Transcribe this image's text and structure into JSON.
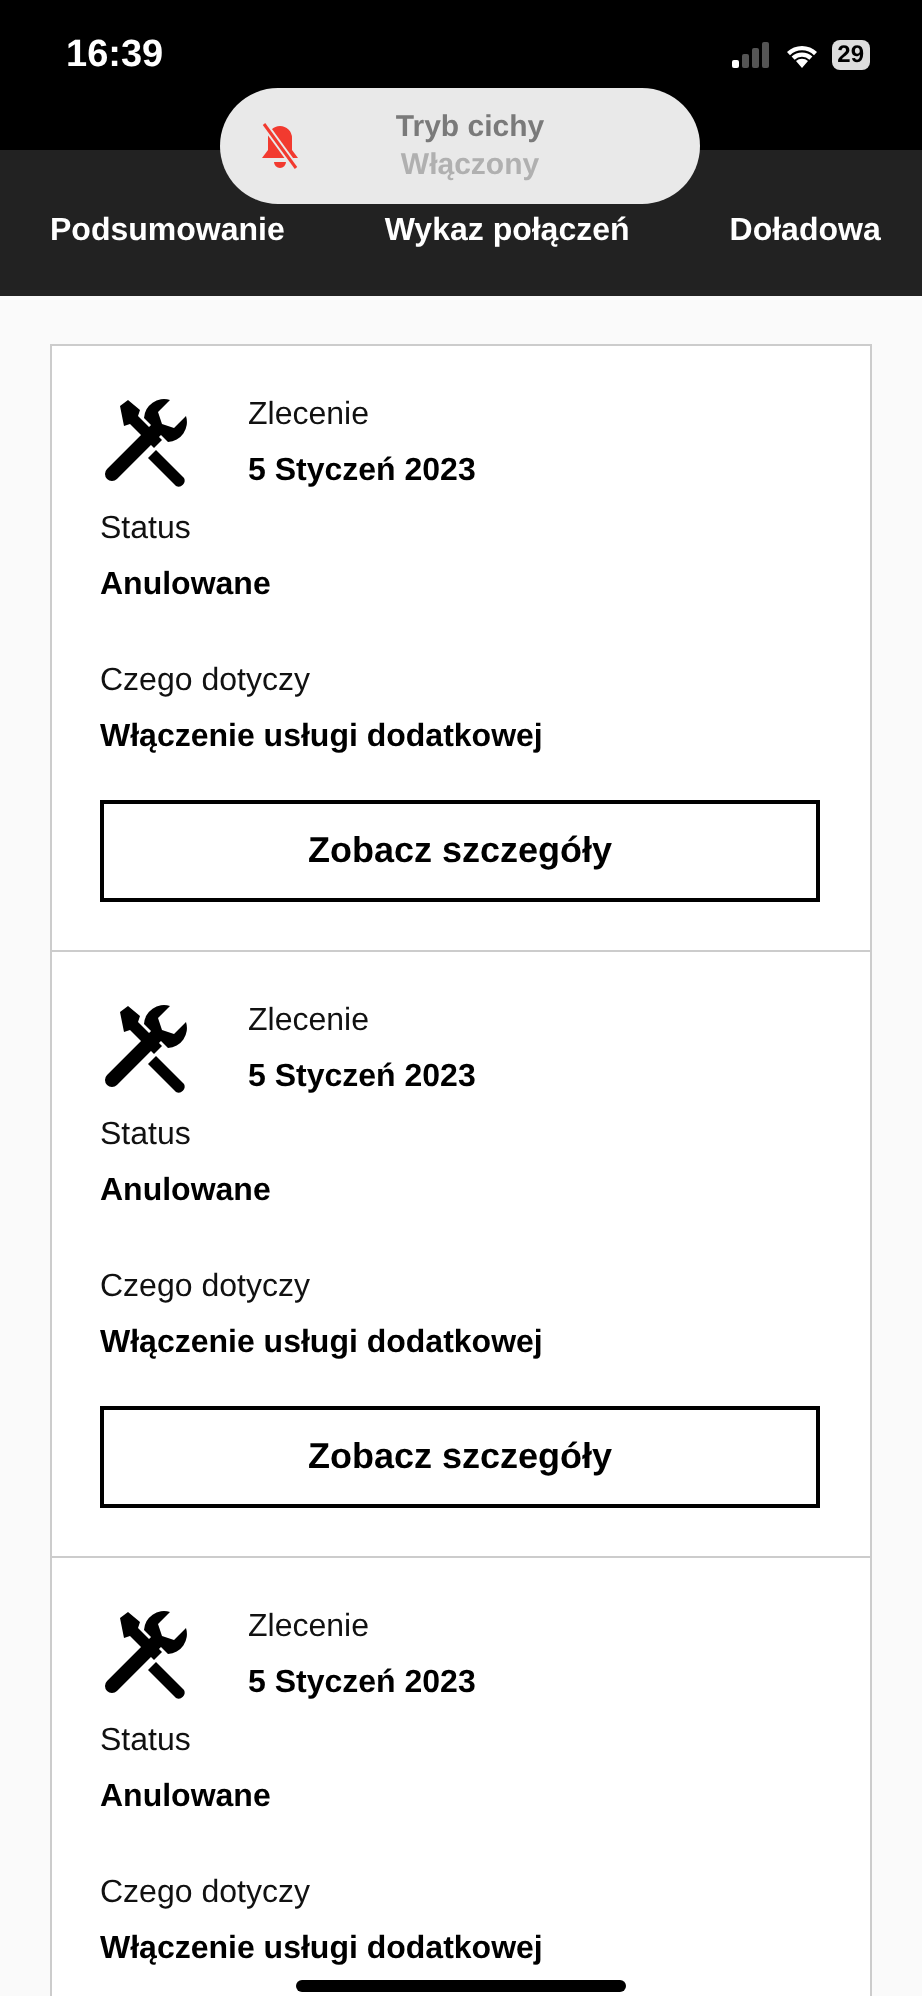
{
  "status_bar": {
    "time": "16:39",
    "battery": "29"
  },
  "toast": {
    "title": "Tryb cichy",
    "subtitle": "Włączony"
  },
  "tabs": [
    {
      "label": "Podsumowanie"
    },
    {
      "label": "Wykaz połączeń"
    },
    {
      "label": "Doładowa"
    }
  ],
  "orders": [
    {
      "order_label": "Zlecenie",
      "date": "5 Styczeń 2023",
      "status_label": "Status",
      "status": "Anulowane",
      "subject_label": "Czego dotyczy",
      "subject": "Włączenie usługi dodatkowej",
      "button": "Zobacz szczegóły"
    },
    {
      "order_label": "Zlecenie",
      "date": "5 Styczeń 2023",
      "status_label": "Status",
      "status": "Anulowane",
      "subject_label": "Czego dotyczy",
      "subject": "Włączenie usługi dodatkowej",
      "button": "Zobacz szczegóły"
    },
    {
      "order_label": "Zlecenie",
      "date": "5 Styczeń 2023",
      "status_label": "Status",
      "status": "Anulowane",
      "subject_label": "Czego dotyczy",
      "subject": "Włączenie usługi dodatkowej"
    }
  ]
}
